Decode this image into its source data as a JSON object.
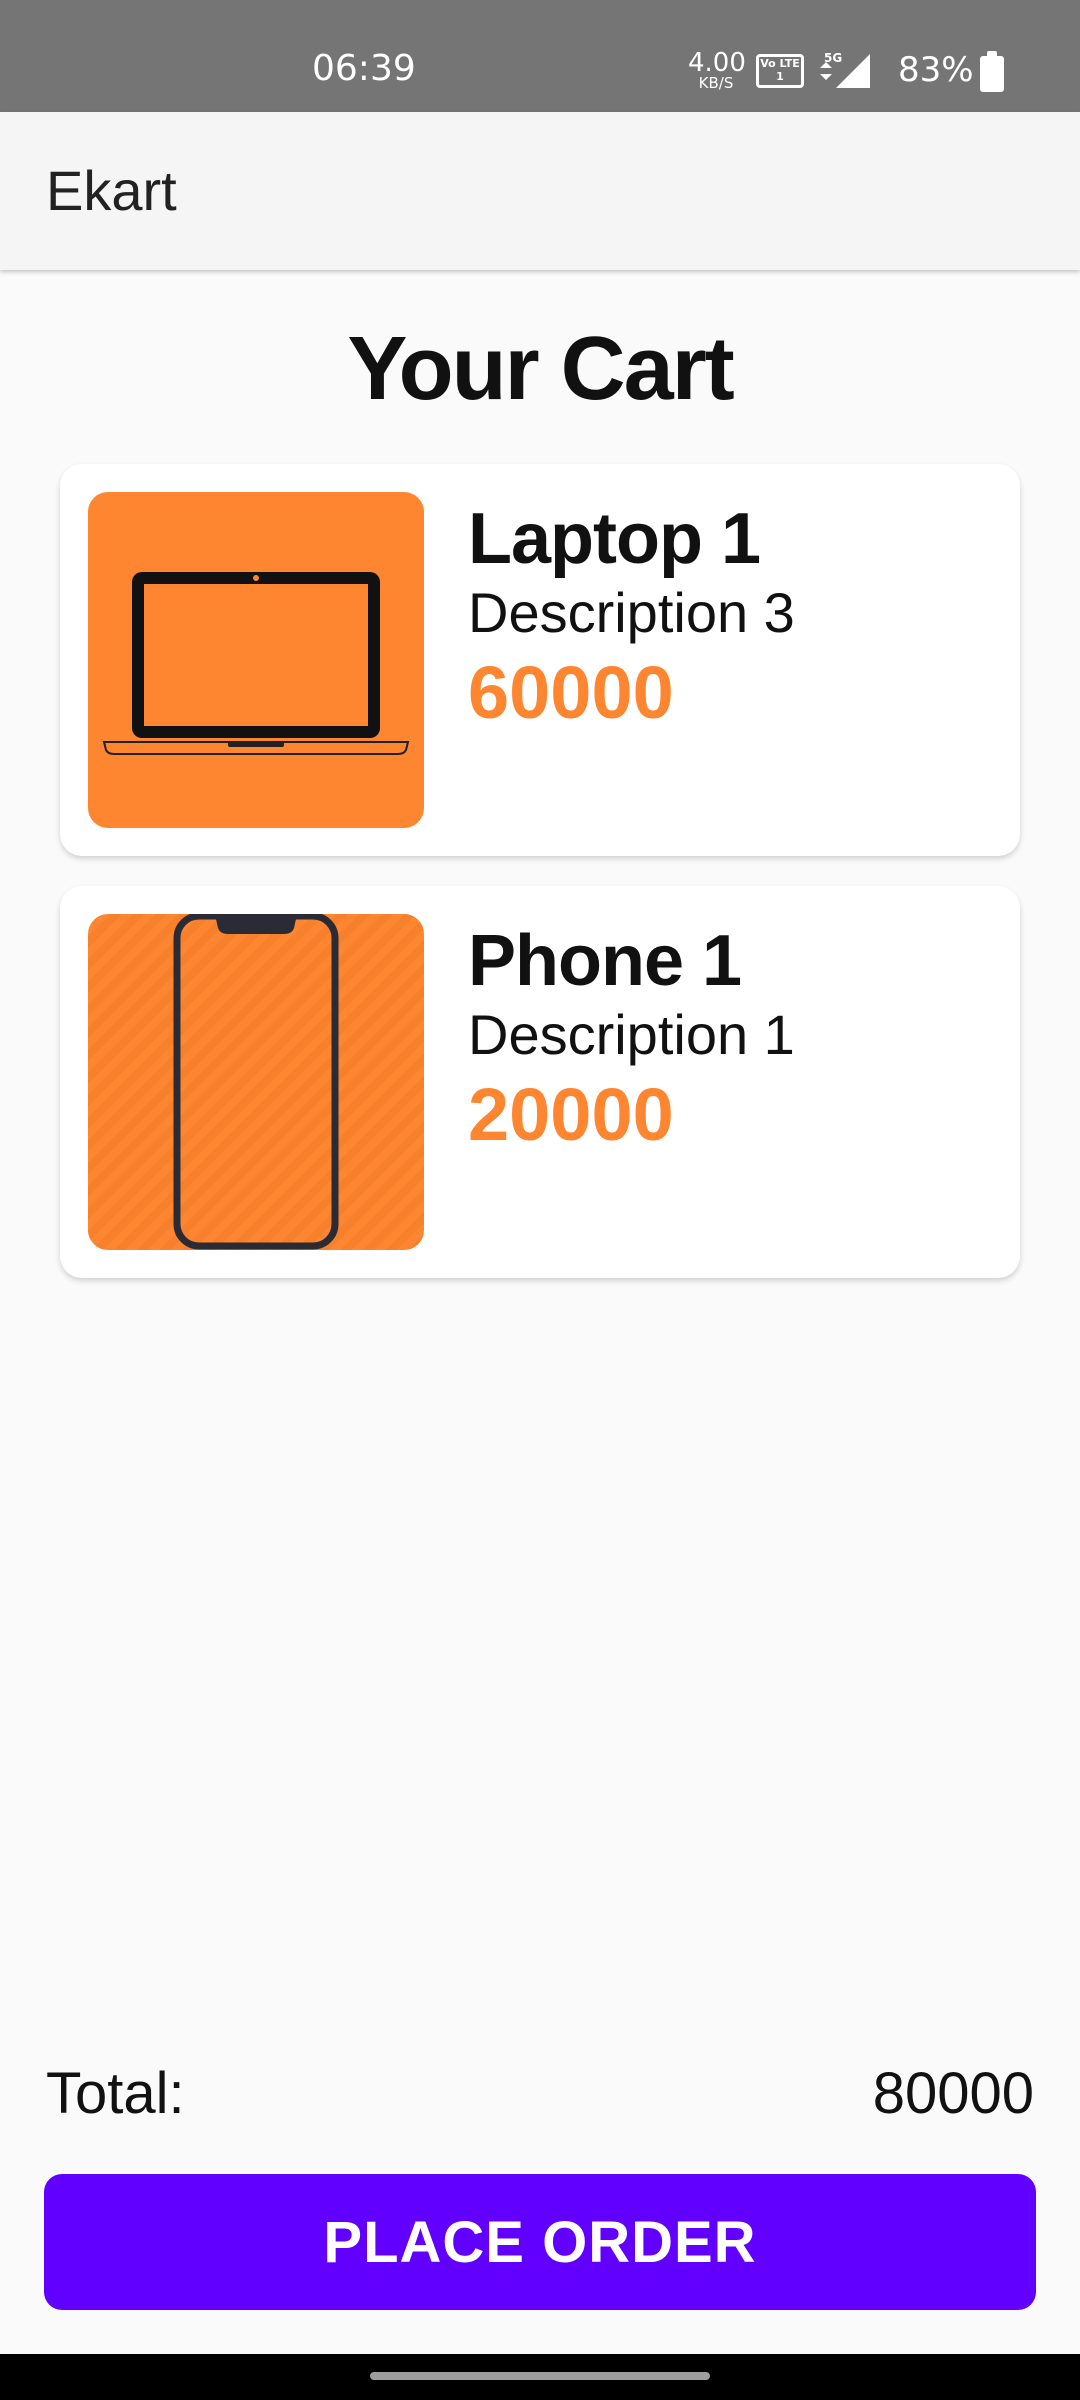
{
  "status_bar": {
    "time": "06:39",
    "net_speed_value": "4.00",
    "net_speed_unit": "KB/S",
    "volte_label": "Vo LTE 1",
    "network": "5G",
    "battery_percent": "83%"
  },
  "app_bar": {
    "title": "Ekart"
  },
  "page": {
    "title": "Your Cart"
  },
  "cart": {
    "items": [
      {
        "name": "Laptop 1",
        "description": "Description 3",
        "price": "60000",
        "icon": "laptop-icon"
      },
      {
        "name": "Phone 1",
        "description": "Description 1",
        "price": "20000",
        "icon": "phone-icon"
      }
    ]
  },
  "summary": {
    "total_label": "Total:",
    "total_value": "80000"
  },
  "actions": {
    "place_order_label": "PLACE ORDER"
  },
  "colors": {
    "accent_orange": "#fe8630",
    "button_purple": "#6200ff",
    "status_bar": "#757575",
    "app_bar": "#f5f5f5",
    "background": "#fafafa"
  }
}
